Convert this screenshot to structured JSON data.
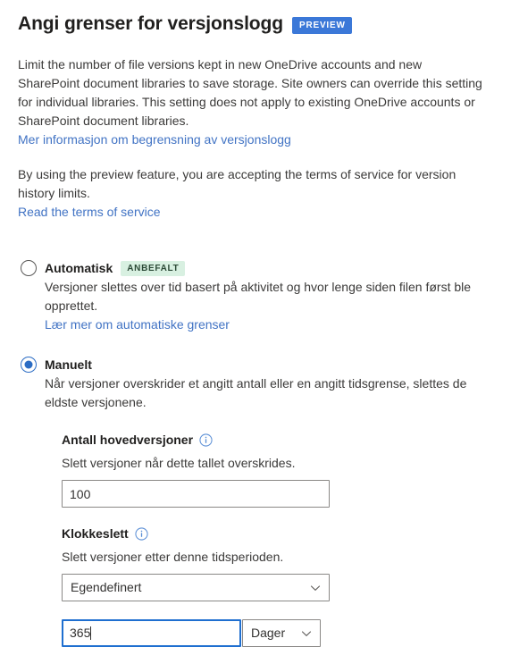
{
  "header": {
    "title": "Angi grenser for versjonslogg",
    "badge": "PREVIEW",
    "badge_color": "#3b78d8"
  },
  "intro": {
    "paragraph1": "Limit the number of file versions kept in new OneDrive accounts and new SharePoint document libraries to save storage. Site owners can override this setting for individual libraries. This setting does not apply to existing OneDrive accounts or SharePoint document libraries.",
    "link1": "Mer informasjon om begrensning av versjonslogg",
    "paragraph2": "By using the preview feature, you are accepting the terms of service for version history limits.",
    "link2": "Read the terms of service",
    "link_color": "#4173c4"
  },
  "options": [
    {
      "id": "automatic",
      "title": "Automatisk",
      "badge": "ANBEFALT",
      "badge_bg": "#d8f0e1",
      "badge_color": "#2c4a37",
      "description": "Versjoner slettes over tid basert på aktivitet og hvor lenge siden filen først ble opprettet.",
      "link": "Lær mer om automatiske grenser",
      "selected": false
    },
    {
      "id": "manual",
      "title": "Manuelt",
      "badge": "",
      "description": "Når versjoner overskrider et angitt antall eller en angitt tidsgrense, slettes de eldste versjonene.",
      "link": "",
      "selected": true
    }
  ],
  "fields": {
    "major_versions": {
      "label": "Antall hovedversjoner",
      "info_icon": "info-icon",
      "description": "Slett versjoner når dette tallet overskrides.",
      "value": "100",
      "placeholder": ""
    },
    "time_period": {
      "label": "Klokkeslett",
      "info_icon": "info-icon",
      "description": "Slett versjoner etter denne tidsperioden.",
      "selected": "Egendefinert",
      "chevron_icon": "chevron-down-icon"
    },
    "duration": {
      "value": "365",
      "placeholder": "",
      "unit": "Dager",
      "unit_chevron_icon": "chevron-down-icon",
      "focus_color": "#1f6fd0"
    }
  }
}
